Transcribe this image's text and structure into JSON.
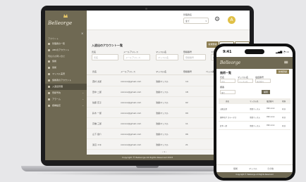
{
  "brand": {
    "name": "Belleorge"
  },
  "header": {
    "admin_label": "管理者名",
    "admin_value": "全て",
    "user_initial": "A"
  },
  "sidebar": {
    "section1": "アカウント",
    "items": [
      {
        "label": "管理者の一覧",
        "active": false
      },
      {
        "label": "ABCのアカウント",
        "active": false
      }
    ],
    "section2": "現在のお問い合せ",
    "items2": [
      {
        "label": "施術",
        "active": false,
        "arrow": ""
      },
      {
        "label": "施術",
        "active": false,
        "arrow": ""
      },
      {
        "label": "マッスル実習",
        "active": false,
        "arrow": ""
      },
      {
        "label": "施術者のアカウント",
        "active": false,
        "arrow": ""
      },
      {
        "label": "入退出管理",
        "active": true,
        "arrow": ""
      },
      {
        "label": "登録予約",
        "active": false,
        "arrow": "⌄"
      },
      {
        "label": "アラーム",
        "active": false,
        "arrow": "⌄"
      },
      {
        "label": "各種設定",
        "active": false,
        "arrow": "⌄"
      }
    ]
  },
  "main": {
    "title": "入退出のアカウント一覧",
    "buttons": [
      "新規登録",
      "入退出アカウント一覧登録",
      "入退出アカウント一覧出力"
    ],
    "filters": [
      {
        "label": "氏名",
        "placeholder": "氏名"
      },
      {
        "label": "メールアドレス",
        "placeholder": "メールアドレス"
      },
      {
        "label": "マッスル名",
        "placeholder": "マッスル名"
      },
      {
        "label": "登録番号",
        "placeholder": "登録番号"
      },
      {
        "label": "ステータス",
        "placeholder": "全て"
      }
    ],
    "extra_label": "検索",
    "columns": [
      "氏名",
      "メールアドレス",
      "マッスル名",
      "登録番号",
      "ベッド番号",
      "ステータス"
    ],
    "rows": [
      [
        "西村 太郎",
        "xxxxxx@gmail.com",
        "池袋マッスル",
        "14",
        "",
        "有効"
      ],
      [
        "田中 二郎",
        "xxxxxx@gmail.com",
        "池袋マッスル",
        "18",
        "",
        "有効"
      ],
      [
        "佐藤 花子",
        "xxxxxx@gmail.com",
        "池袋マッスル",
        "02",
        "",
        "有効"
      ],
      [
        "鈴木 一郎",
        "xxxxxx@gmail.com",
        "池袋マッスル",
        "09",
        "",
        "退会"
      ],
      [
        "高橋 三郎",
        "xxxxxx@gmail.com",
        "池袋マッスル",
        "11",
        "",
        "有効"
      ],
      [
        "山下 健介",
        "xxxxxx@gmail.com",
        "池袋マッスル",
        "06",
        "",
        "有効"
      ],
      [
        "渡辺 ユキ",
        "xxxxxx@gmail.com",
        "池袋マッスル",
        "21",
        "",
        "有効"
      ]
    ],
    "pagination": "‹  1  ›",
    "footer": "Copyright © Belleorge All Rights Reserved 2023"
  },
  "phone": {
    "time": "9:41",
    "status": "▂▄▆ ◔ ▭",
    "title": "施術一覧",
    "new_button": "新規登録",
    "filter_labels": [
      "氏名",
      "マッスル名",
      "電話番号",
      "順番"
    ],
    "filter_placeholders": [
      "氏名",
      "マッスル名",
      "電話番号",
      "全て"
    ],
    "search_button": "検索",
    "columns": [
      "氏名",
      "マッスル名",
      "電話番号",
      "状態"
    ],
    "rows": [
      [
        "山田太郎",
        "池袋マッスル",
        "090-xxxx",
        "有効"
      ],
      [
        "田中花子 ステータス",
        "池袋マッスル",
        "090-xxxx",
        "有効"
      ],
      [
        "鈴木一郎",
        "池袋マッスル",
        "090-xxxx",
        "有効"
      ]
    ],
    "nav": [
      "施術",
      "マッスル",
      "その他"
    ],
    "footer": "Copyright © Belleorge All Rights Reserved"
  },
  "colors": {
    "brand": "#6f6953",
    "accent": "#8d7f54"
  }
}
